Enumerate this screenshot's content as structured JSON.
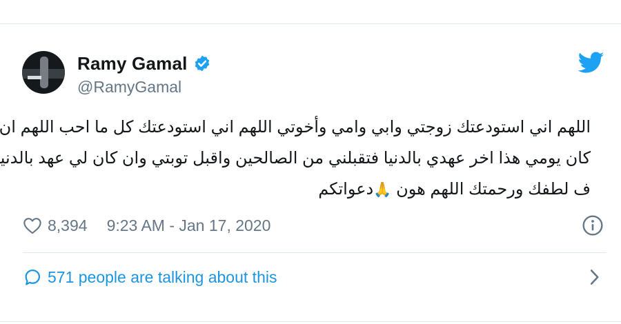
{
  "user": {
    "display_name": "Ramy Gamal",
    "handle": "@RamyGamal",
    "verified": true
  },
  "tweet": {
    "lines": [
      "اللهم اني استودعتك زوجتي وابي وامي وأخوتي اللهم اني استودعتك كل ما احب اللهم ان",
      "كان يومي هذا اخر عهدي بالدنيا فتقبلني من الصالحين واقبل توبتي وان كان لي عهد بالدنيا",
      "ف لطفك ورحمتك اللهم هون",
      "🙏",
      "دعواتكم"
    ]
  },
  "stats": {
    "likes": "8,394",
    "timestamp": "9:23 AM - Jan 17, 2020"
  },
  "conversation": {
    "label": "571 people are talking about this"
  },
  "icons": {
    "bird": "twitter-bird-icon",
    "verified": "verified-badge-icon",
    "heart": "heart-icon",
    "info": "info-icon",
    "bubble": "speech-bubble-icon",
    "chevron": "chevron-right-icon"
  },
  "colors": {
    "accent": "#1da1f2",
    "link": "#1b95e0",
    "muted": "#657786"
  }
}
